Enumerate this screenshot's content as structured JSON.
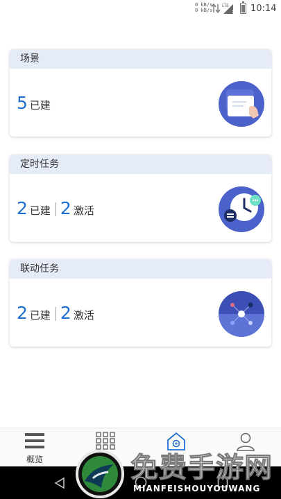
{
  "status_bar": {
    "net_speed_up": "0 kB/s",
    "net_speed_down": "0 kB/s",
    "network_type": "LTE",
    "time": "10:14"
  },
  "cards": [
    {
      "title": "场景",
      "count_built": "5",
      "built_label": "已建",
      "illustration": "phone-touch-icon"
    },
    {
      "title": "定时任务",
      "count_built": "2",
      "built_label": "已建",
      "count_active": "2",
      "active_label": "激活",
      "illustration": "clock-icon"
    },
    {
      "title": "联动任务",
      "count_built": "2",
      "built_label": "已建",
      "count_active": "2",
      "active_label": "激活",
      "illustration": "linkage-network-icon"
    }
  ],
  "bottom_nav": [
    {
      "label": "概览",
      "icon": "list-icon",
      "active": false
    },
    {
      "label": "",
      "icon": "grid-icon",
      "active": false
    },
    {
      "label": "",
      "icon": "smart-home-icon",
      "active": true
    },
    {
      "label": "",
      "icon": "user-icon",
      "active": false
    }
  ],
  "watermark": {
    "title": "免费手游网",
    "subtitle": "MIANFEISHOUYOUWANG"
  },
  "colors": {
    "accent": "#1f6fd1",
    "card_header_bg": "#e6ecf7",
    "illustration_blue": "#4a62c9"
  }
}
